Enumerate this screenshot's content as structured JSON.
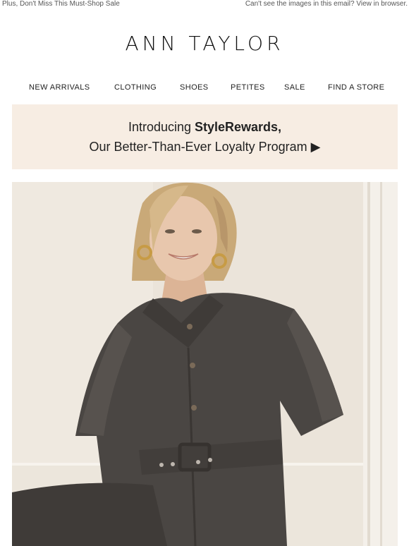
{
  "preheader": {
    "left_text": "Plus, Don't Miss This Must-Shop Sale",
    "right_text": "Can't see the images in this email? View in browser."
  },
  "brand": {
    "logo_text": "ANN TAYLOR"
  },
  "nav": {
    "items": [
      {
        "label": "NEW ARRIVALS"
      },
      {
        "label": "CLOTHING"
      },
      {
        "label": "SHOES"
      },
      {
        "label": "PETITES"
      },
      {
        "label": "SALE"
      },
      {
        "label": "FIND A STORE"
      }
    ]
  },
  "banner": {
    "line1_prefix": "Introducing ",
    "line1_bold": "StyleRewards,",
    "line2": "Our Better-Than-Ever Loyalty Program ▶",
    "background": "#f7ede3"
  },
  "hero": {
    "colors": {
      "wall": "#e9e2d8",
      "dress": "#4a4643",
      "skin": "#e8c7ad",
      "hair": "#c9a978"
    }
  }
}
